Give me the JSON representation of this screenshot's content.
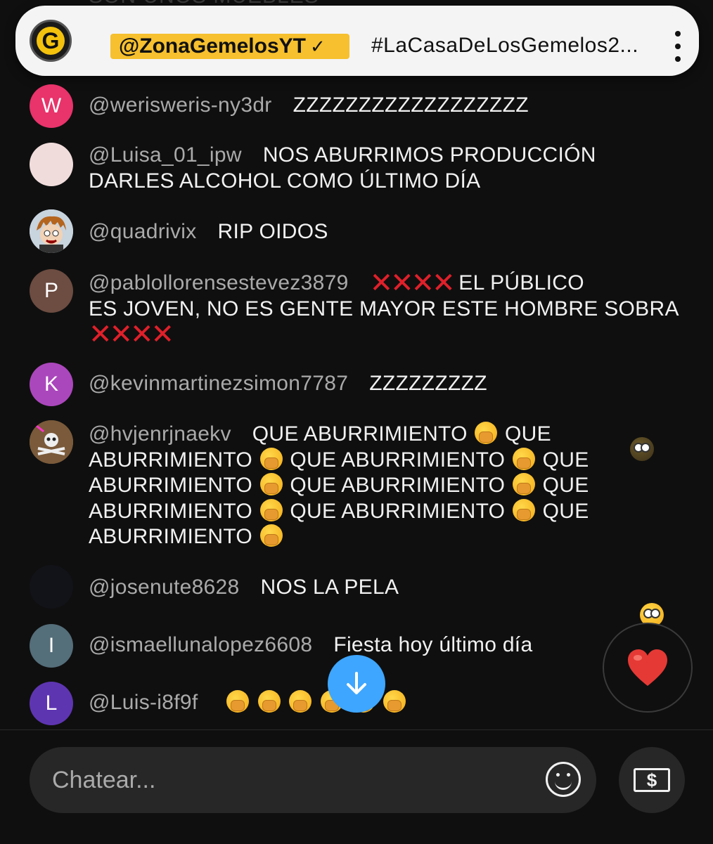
{
  "pinned": {
    "channel": "@ZonaGemelosYT",
    "verified_mark": "✓",
    "text": "#LaCasaDeLosGemelos2...",
    "avatar_letter": "G"
  },
  "messages": [
    {
      "author": "@werisweris-ny3dr",
      "text": "ZZZZZZZZZZZZZZZZZZ",
      "avatar": "W",
      "avatar_color": "#e8336b"
    },
    {
      "author": "@Luisa_01_ipw",
      "text": "NOS ABURRIMOS PRODUCCIÓN",
      "text2": "DARLES ALCOHOL COMO ÚLTIMO DÍA",
      "avatar": "",
      "avatar_color": "#f1dcdc"
    },
    {
      "author": "@quadrivix",
      "text": "RIP OIDOS",
      "avatar": "",
      "avatar_color": "#b9c9d6"
    },
    {
      "author": "@pablollorensestevez3879",
      "text": "EL PÚBLICO",
      "text2": "ES JOVEN, NO ES GENTE MAYOR ESTE HOMBRE SOBRA",
      "cross": "✕✕✕✕",
      "avatar": "P",
      "avatar_color": "#6d4c41"
    },
    {
      "author": "@kevinmartinezsimon7787",
      "text": "ZZZZZZZZZ",
      "avatar": "K",
      "avatar_color": "#ab47bc"
    },
    {
      "author": "@hvjenrjnaekv",
      "phrase": "QUE ABURRIMIENTO",
      "q": "QUE",
      "a": "ABURRIMIENTO",
      "avatar": "",
      "avatar_color": "#8a6a4a"
    },
    {
      "author": "@josenute8628",
      "text": "NOS LA PELA",
      "avatar": "",
      "avatar_color": "#121318"
    },
    {
      "author": "@ismaellunalopez6608",
      "text": "Fiesta hoy último día",
      "avatar": "I",
      "avatar_color": "#546e7a"
    },
    {
      "author": "@Luis-i8f9f",
      "avatar": "L",
      "avatar_color": "#5e35b1"
    }
  ],
  "top_ghost": "SON UNOS MUEBLES",
  "composer": {
    "placeholder": "Chatear..."
  },
  "icons": {
    "scroll": "arrow-down-icon",
    "heart": "heart-icon",
    "emoji": "smile-icon",
    "super_chat": "dollar-bill-icon"
  },
  "colors": {
    "accent": "#3ea6ff",
    "badge": "#f6c02e",
    "cross": "#e0202a",
    "heart": "#e53935"
  }
}
